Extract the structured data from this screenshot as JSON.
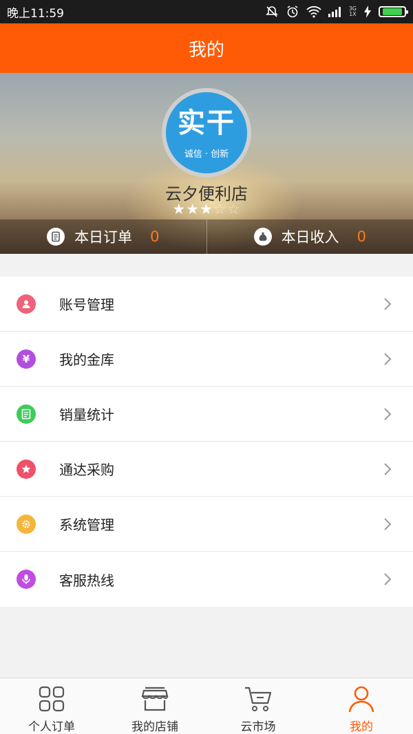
{
  "status_bar": {
    "time": "晚上11:59",
    "network_top": "3G",
    "network_bottom": "1X"
  },
  "header": {
    "title": "我的"
  },
  "profile": {
    "logo_main": "实干",
    "logo_sub": "诚信 · 创新",
    "store_name": "云夕便利店",
    "rating": {
      "filled": 3,
      "total": 5
    },
    "stats": [
      {
        "label": "本日订单",
        "value": "0",
        "icon": "order-icon"
      },
      {
        "label": "本日收入",
        "value": "0",
        "icon": "money-bag-icon"
      }
    ]
  },
  "menu": {
    "items": [
      {
        "label": "账号管理",
        "icon": "person-icon",
        "color": "#f0617a"
      },
      {
        "label": "我的金库",
        "icon": "yen-icon",
        "color": "#b34fe0"
      },
      {
        "label": "销量统计",
        "icon": "document-icon",
        "color": "#3dcc5a"
      },
      {
        "label": "通达采购",
        "icon": "star-icon",
        "color": "#f0506a"
      },
      {
        "label": "系统管理",
        "icon": "gear-icon",
        "color": "#f5b53a"
      },
      {
        "label": "客服热线",
        "icon": "microphone-icon",
        "color": "#c04ce0"
      }
    ]
  },
  "tabbar": {
    "tabs": [
      {
        "label": "个人订单",
        "icon": "grid-icon",
        "active": false
      },
      {
        "label": "我的店铺",
        "icon": "shop-icon",
        "active": false
      },
      {
        "label": "云市场",
        "icon": "cart-icon",
        "active": false
      },
      {
        "label": "我的",
        "icon": "person-icon",
        "active": true
      }
    ]
  },
  "colors": {
    "accent": "#ff5a06",
    "stat_value": "#ff7a1a"
  }
}
